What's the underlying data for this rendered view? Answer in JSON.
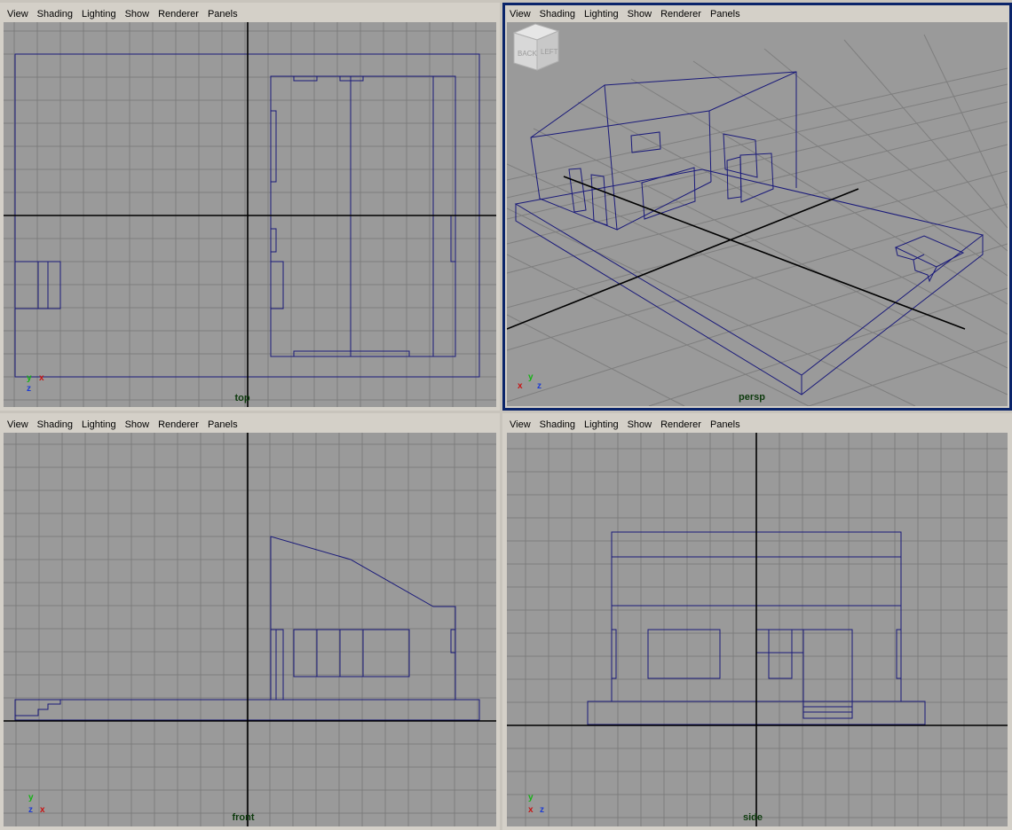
{
  "menu": [
    "View",
    "Shading",
    "Lighting",
    "Show",
    "Renderer",
    "Panels"
  ],
  "panels": {
    "top": {
      "camera": "top"
    },
    "persp": {
      "camera": "persp"
    },
    "front": {
      "camera": "front"
    },
    "side": {
      "camera": "side"
    }
  },
  "axes": {
    "x": "x",
    "y": "y",
    "z": "z"
  },
  "viewcube": {
    "face_back": "BACK",
    "face_left": "LEFT"
  },
  "colors": {
    "viewport_bg": "#9a9a9a",
    "grid": "#7d7d7d",
    "wire": "#1a1a7a",
    "origin_axis": "#000000",
    "active_border": "#0a246a"
  }
}
